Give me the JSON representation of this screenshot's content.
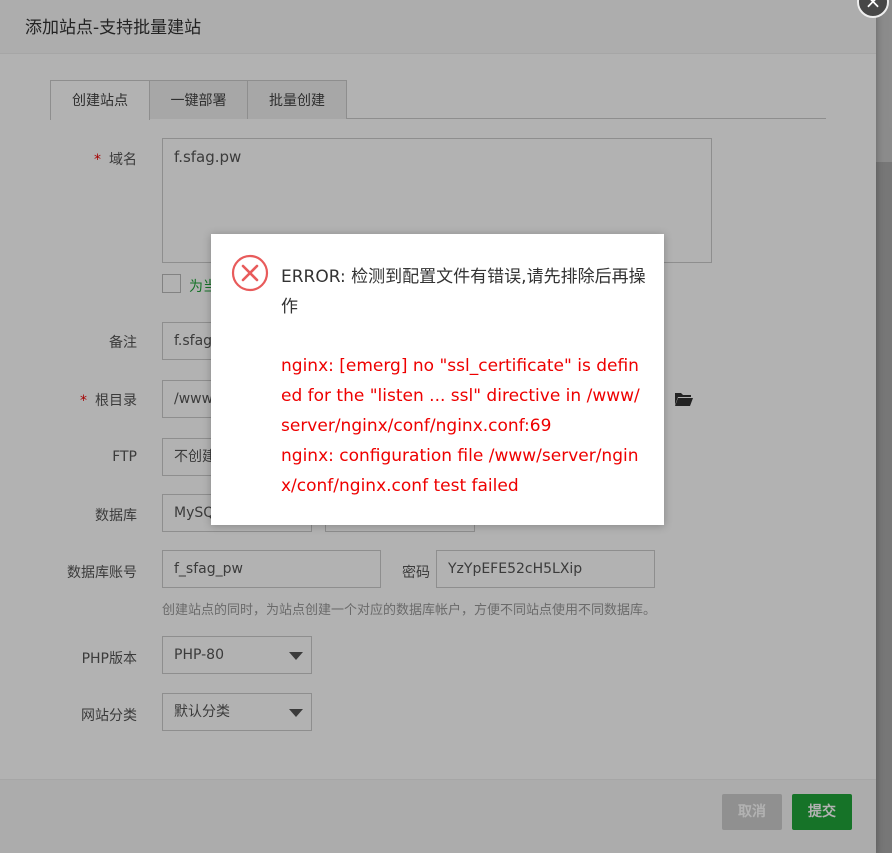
{
  "dialog": {
    "title": "添加站点-支持批量建站",
    "close_glyph": "×"
  },
  "tabs": [
    {
      "label": "创建站点",
      "active": true
    },
    {
      "label": "一键部署",
      "active": false
    },
    {
      "label": "批量创建",
      "active": false
    }
  ],
  "form": {
    "domain": {
      "label": "域名",
      "required_mark": "*",
      "value": "f.sfag.pw"
    },
    "checkbox_label": "为当",
    "remark": {
      "label": "备注",
      "value": "f.sfag"
    },
    "root": {
      "label": "根目录",
      "required_mark": "*",
      "value": "/www"
    },
    "ftp": {
      "label": "FTP",
      "value": "不创建"
    },
    "database": {
      "label": "数据库",
      "value": "MySQ"
    },
    "db_account": {
      "label": "数据库账号",
      "value": "f_sfag_pw"
    },
    "password": {
      "label": "密码",
      "value": "YzYpEFE52cH5LXip"
    },
    "db_hint": "创建站点的同时，为站点创建一个对应的数据库帐户，方便不同站点使用不同数据库。",
    "php": {
      "label": "PHP版本",
      "value": "PHP-80"
    },
    "category": {
      "label": "网站分类",
      "value": "默认分类"
    }
  },
  "footer": {
    "cancel_label": "取消",
    "submit_label": "提交"
  },
  "error_message": {
    "title": "ERROR: 检测到配置文件有错误,请先排除后再操作",
    "lines": [
      "nginx: [emerg] no \"ssl_certificate\" is defined for the \"listen ... ssl\" directive in /www/server/nginx/conf/nginx.conf:69",
      "nginx: configuration file /www/server/nginx/conf/nginx.conf test failed"
    ],
    "icon": "error-circle-x-icon"
  },
  "colors": {
    "accent": "#20a53a",
    "error": "#e00000",
    "required": "#ee0000"
  }
}
